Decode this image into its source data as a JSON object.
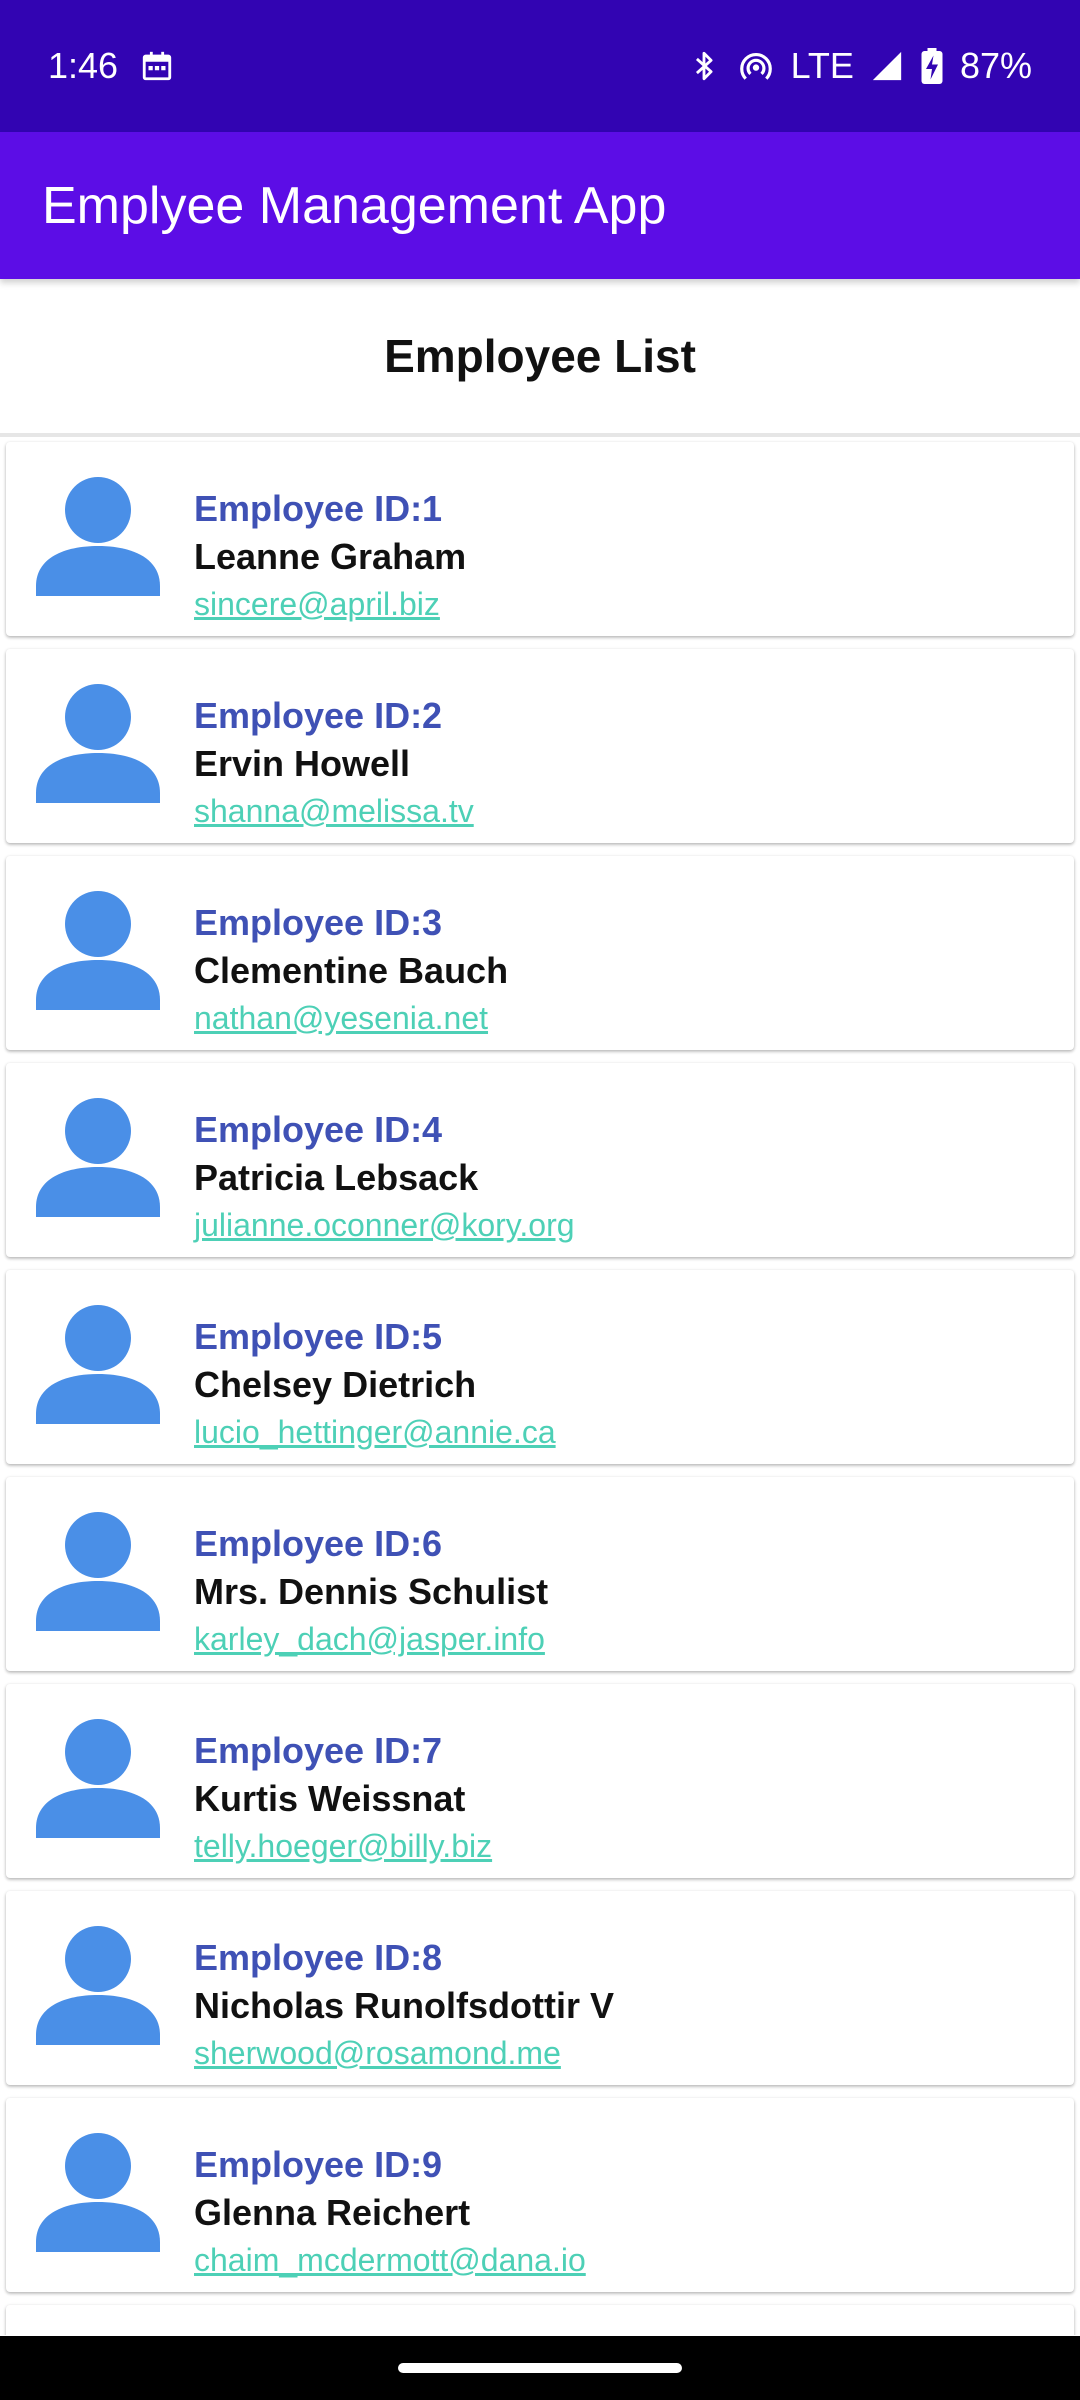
{
  "status_bar": {
    "time": "1:46",
    "network": "LTE",
    "battery": "87%",
    "icons": [
      "calendar-icon",
      "bluetooth-icon",
      "hotspot-icon",
      "signal-icon",
      "battery-charging-icon"
    ]
  },
  "app_bar": {
    "title": "Emplyee Management App"
  },
  "list": {
    "heading": "Employee List"
  },
  "employees": [
    {
      "id": "Employee ID:1",
      "name": "Leanne Graham",
      "email": "sincere@april.biz"
    },
    {
      "id": "Employee ID:2",
      "name": "Ervin Howell",
      "email": "shanna@melissa.tv"
    },
    {
      "id": "Employee ID:3",
      "name": "Clementine Bauch",
      "email": "nathan@yesenia.net"
    },
    {
      "id": "Employee ID:4",
      "name": "Patricia Lebsack",
      "email": "julianne.oconner@kory.org"
    },
    {
      "id": "Employee ID:5",
      "name": "Chelsey Dietrich",
      "email": "lucio_hettinger@annie.ca"
    },
    {
      "id": "Employee ID:6",
      "name": "Mrs. Dennis Schulist",
      "email": "karley_dach@jasper.info"
    },
    {
      "id": "Employee ID:7",
      "name": "Kurtis Weissnat",
      "email": "telly.hoeger@billy.biz"
    },
    {
      "id": "Employee ID:8",
      "name": "Nicholas Runolfsdottir V",
      "email": "sherwood@rosamond.me"
    },
    {
      "id": "Employee ID:9",
      "name": "Glenna Reichert",
      "email": "chaim_mcdermott@dana.io"
    },
    {
      "id": "",
      "name": "",
      "email": ""
    }
  ],
  "colors": {
    "status_bar": "#3204b2",
    "app_bar": "#5c0de6",
    "employee_id": "#3f51b5",
    "email_link": "#4dd0b6",
    "avatar": "#4a8fe7"
  }
}
